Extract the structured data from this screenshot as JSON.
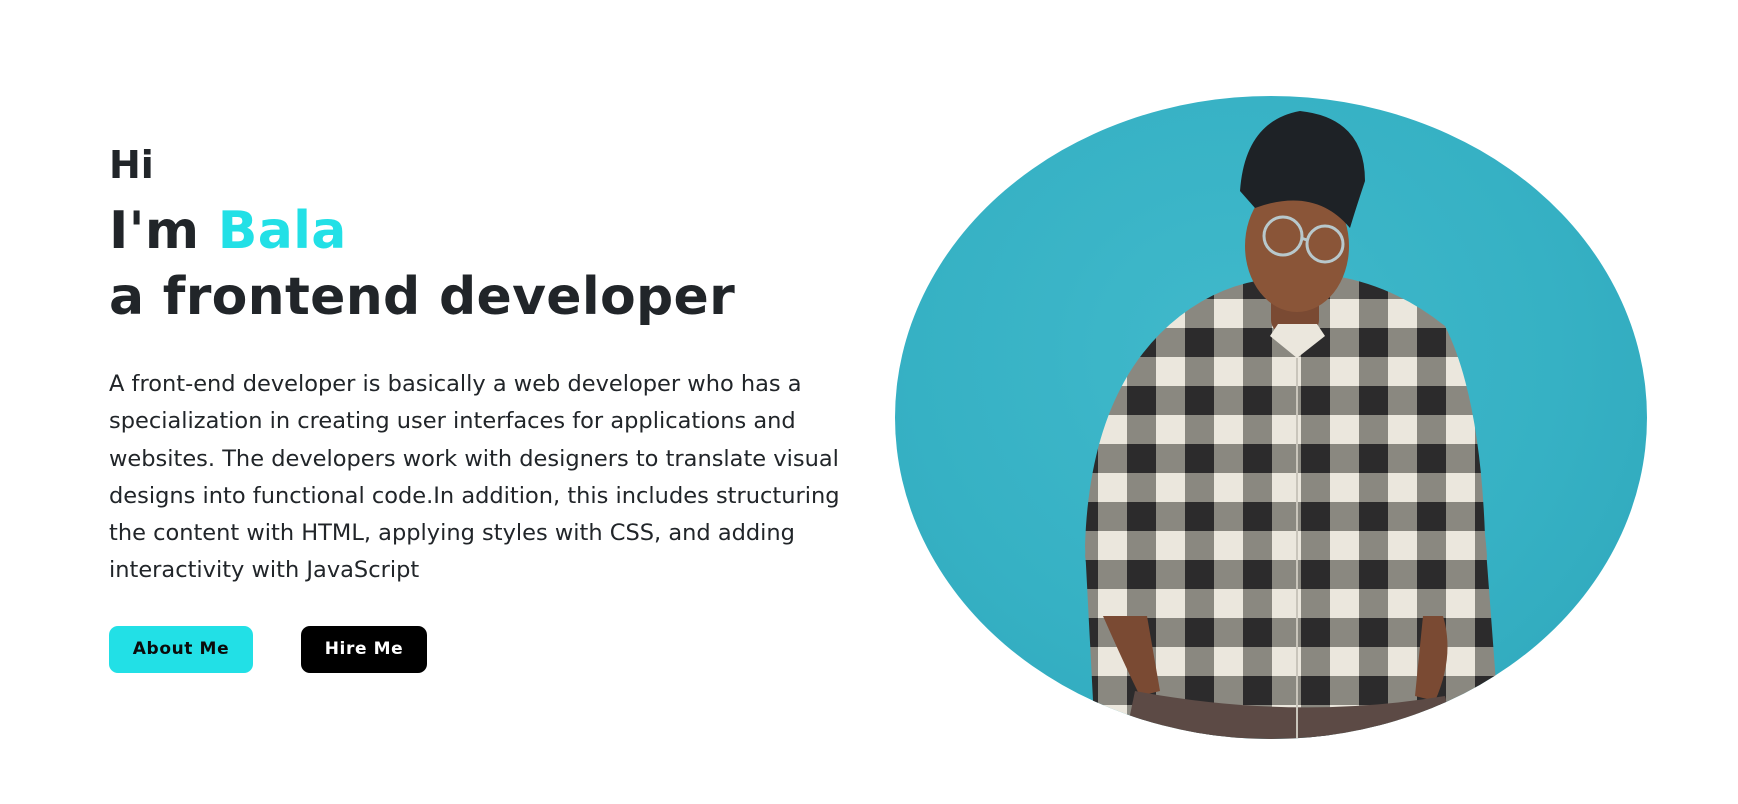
{
  "hero": {
    "greeting": "Hi",
    "headline_prefix": "I'm ",
    "name": "Bala",
    "role": "a frontend developer",
    "description": "A front-end developer is basically a web developer who has a specialization in creating user interfaces for applications and websites. The developers work with designers to translate visual designs into functional code.In addition, this includes structuring the content with HTML, applying styles with CSS, and adding interactivity with JavaScript",
    "about_button": "About Me",
    "hire_button": "Hire Me"
  },
  "colors": {
    "accent": "#22e0e6",
    "photo_background": "#36b1c4",
    "text": "#212529",
    "hire_button_bg": "#000000"
  },
  "photo": {
    "icon": "profile-photo"
  }
}
